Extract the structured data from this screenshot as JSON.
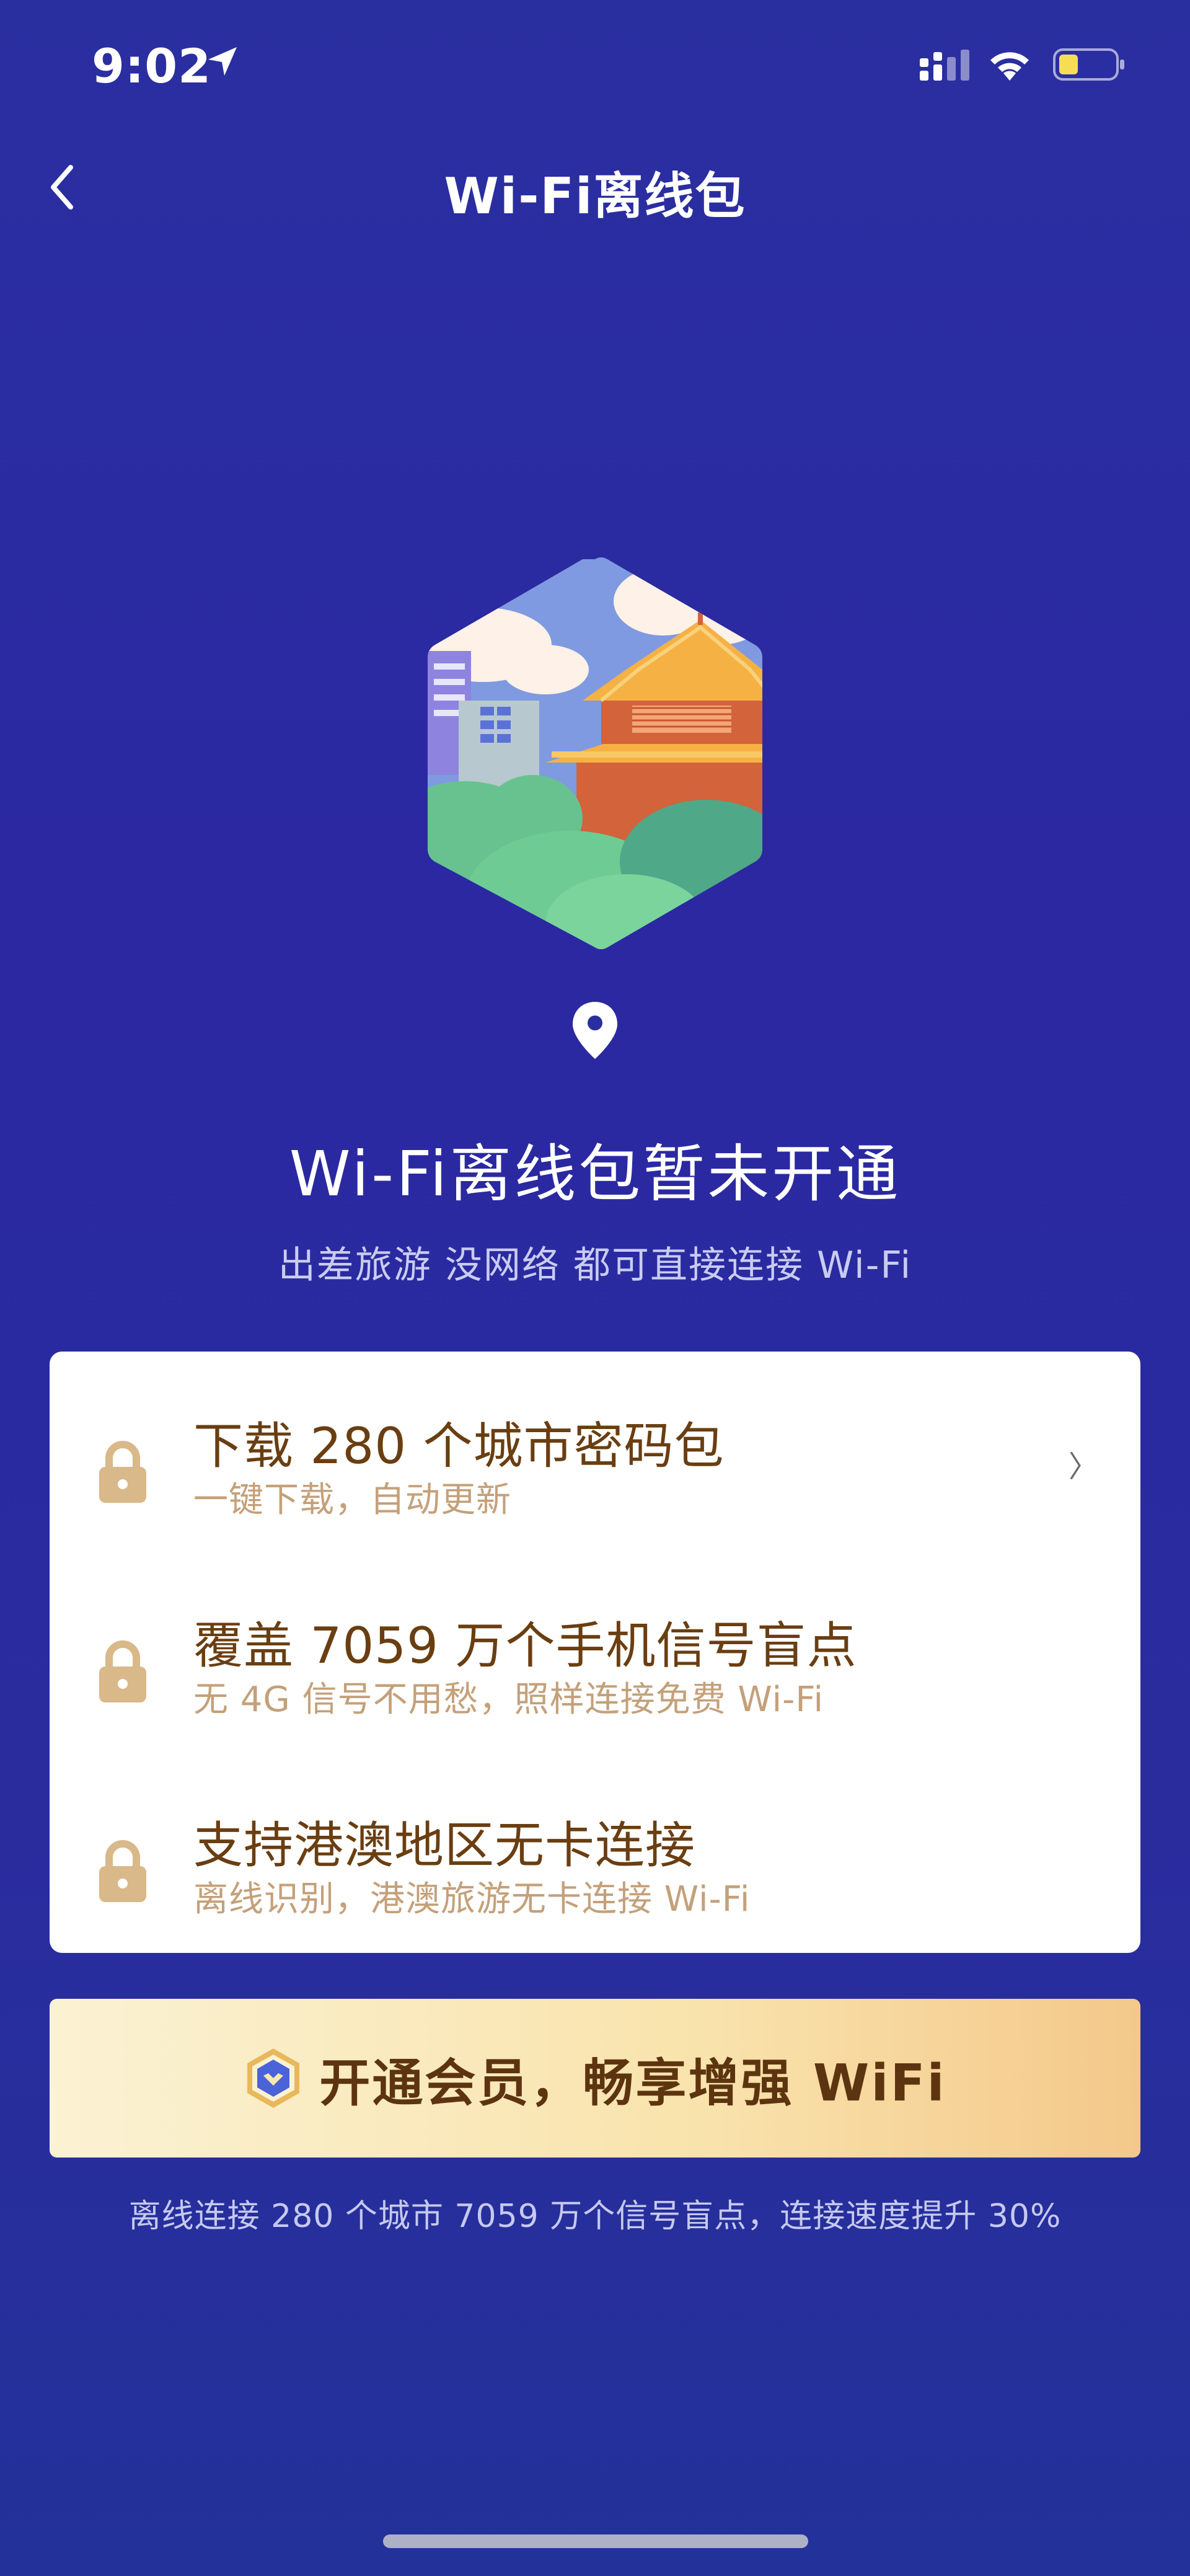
{
  "status_bar": {
    "time": "9:02",
    "icons": [
      "location-arrow-icon",
      "signal-icon",
      "wifi-icon",
      "battery-icon"
    ],
    "battery_color": "#f7dd55"
  },
  "nav": {
    "back_icon": "chevron-left-icon",
    "title": "Wi-Fi离线包"
  },
  "hero": {
    "illustration": "city-palace-hexagon-illustration",
    "pin_icon": "map-pin-icon",
    "headline": "Wi-Fi离线包暂未开通",
    "subline": "出差旅游 没网络 都可直接连接 Wi-Fi"
  },
  "features": [
    {
      "icon": "lock-icon",
      "title": "下载 280 个城市密码包",
      "subtitle": "一键下载，自动更新",
      "chevron": "〉"
    },
    {
      "icon": "lock-icon",
      "title": "覆盖 7059 万个手机信号盲点",
      "subtitle": "无 4G 信号不用愁，照样连接免费 Wi-Fi"
    },
    {
      "icon": "lock-icon",
      "title": "支持港澳地区无卡连接",
      "subtitle": "离线识别，港澳旅游无卡连接 Wi-Fi"
    }
  ],
  "cta": {
    "icon": "vip-shield-icon",
    "label": "开通会员，畅享增强 WiFi"
  },
  "footnote": "离线连接 280 个城市 7059 万个信号盲点，连接速度提升 30%",
  "colors": {
    "background": "#2a2fa0",
    "feature_title": "#6a3e11",
    "feature_subtitle": "#c4a07a",
    "cta_gold": "#f9e3ac",
    "cta_text": "#5d3410"
  }
}
